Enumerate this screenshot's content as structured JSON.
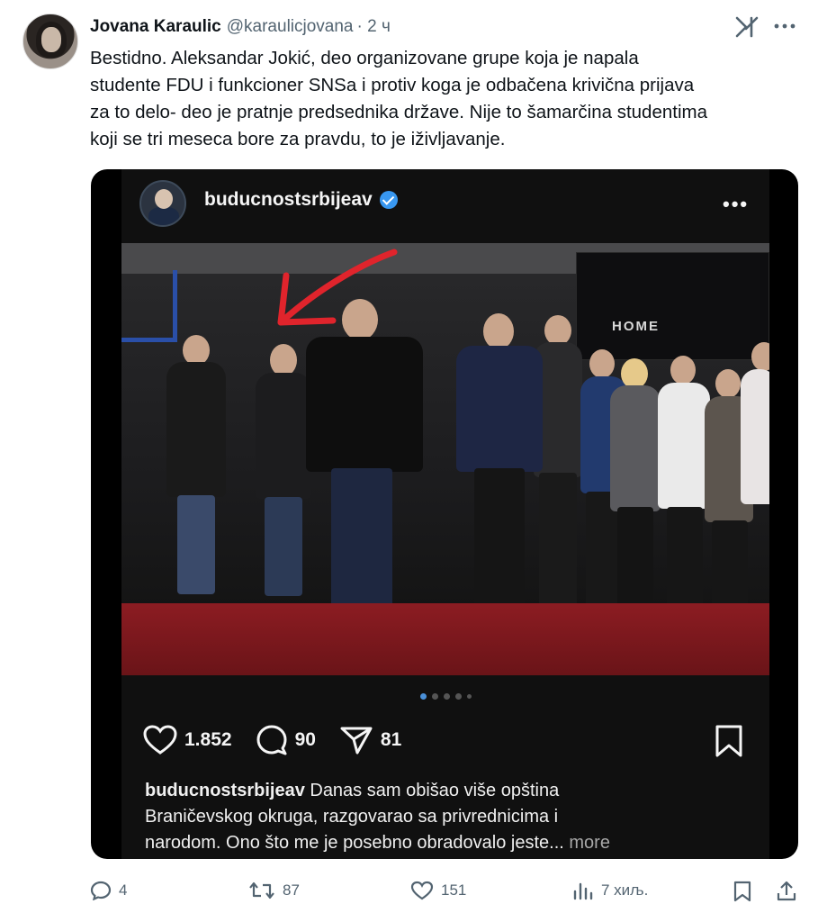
{
  "tweet": {
    "author_name": "Jovana Karaulic",
    "author_handle": "@karaulicjovana",
    "time": "· 2 ч",
    "text_lines": [
      "Bestidno. Aleksandar Jokić, deo organizovane grupe koja je napala",
      "studente FDU i funkcioner SNSa i protiv koga je odbačena krivična prijava",
      "za to delo- deo je pratnje predsednika države. Nije to šamarčina studentima",
      "koji se tri meseca bore za pravdu, to je iživljavanje."
    ],
    "icons": {
      "grok": "grok-icon",
      "more": "more-icon"
    }
  },
  "embedded_post": {
    "username": "buducnostsrbijeav",
    "banner_text": "HOME",
    "likes": "1.852",
    "comments": "90",
    "shares": "81",
    "caption_user": "buducnostsrbijeav",
    "caption_lines": [
      " Danas sam obišao više opština",
      "Braničevskog okruga, razgovarao sa privrednicima i",
      "narodom. Ono što me je posebno obradovalo jeste..."
    ],
    "caption_more": " more",
    "carousel_dots": 5,
    "carousel_active": 1
  },
  "footer": {
    "replies": "4",
    "retweets": "87",
    "likes": "151",
    "views": "7 хиљ."
  },
  "colors": {
    "text": "#0f1419",
    "secondary": "#536471",
    "verified": "#3897f0",
    "carpet": "#8c1c22",
    "arrow": "#e0242c"
  }
}
